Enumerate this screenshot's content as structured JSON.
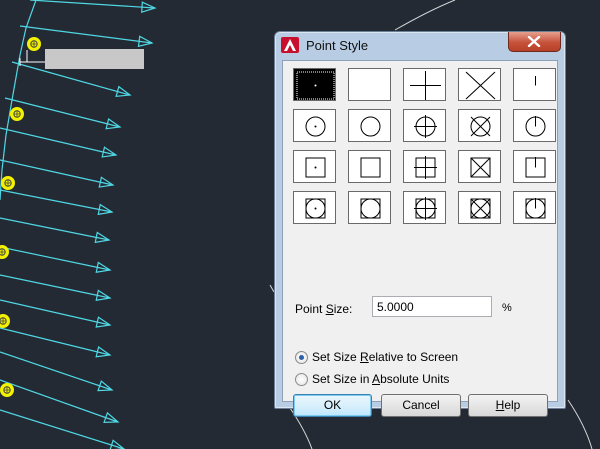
{
  "dialog": {
    "title": "Point Style",
    "app_icon": "autocad-a-icon",
    "close_icon": "close-x-icon",
    "point_styles": [
      {
        "name": "dot",
        "selected": true
      },
      {
        "name": "none"
      },
      {
        "name": "plus"
      },
      {
        "name": "x"
      },
      {
        "name": "tick"
      },
      {
        "name": "circle-dot"
      },
      {
        "name": "circle"
      },
      {
        "name": "circle-plus"
      },
      {
        "name": "circle-x"
      },
      {
        "name": "circle-tick"
      },
      {
        "name": "square-dot"
      },
      {
        "name": "square"
      },
      {
        "name": "square-plus"
      },
      {
        "name": "square-x"
      },
      {
        "name": "square-tick"
      },
      {
        "name": "square-circle-dot"
      },
      {
        "name": "square-circle"
      },
      {
        "name": "square-circle-plus"
      },
      {
        "name": "square-circle-x"
      },
      {
        "name": "square-circle-tick"
      }
    ],
    "point_size": {
      "label_pre": "Point ",
      "label_u": "S",
      "label_post": "ize:",
      "value": "5.0000",
      "unit": "%"
    },
    "size_options": [
      {
        "pre": "Set Size ",
        "u": "R",
        "post": "elative to Screen",
        "selected": true
      },
      {
        "pre": "Set Size in ",
        "u": "A",
        "post": "bsolute Units",
        "selected": false
      }
    ],
    "buttons": {
      "ok": "OK",
      "cancel": "Cancel",
      "help_u": "H",
      "help_post": "elp"
    }
  },
  "colors": {
    "background": "#232a34",
    "cyan": "#4fd8e4",
    "yellow": "#f2f200"
  }
}
